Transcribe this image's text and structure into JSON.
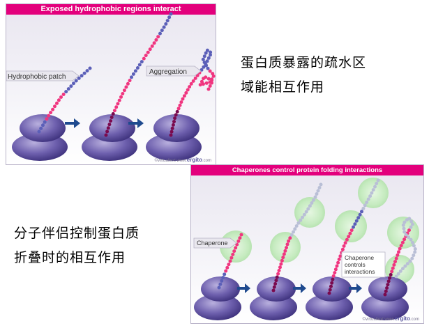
{
  "panel1": {
    "title": "Exposed hydrophobic regions interact",
    "hydrophobic_label": "Hydrophobic patch",
    "aggregation_label": "Aggregation",
    "credit_prefix": "©virtualtext www.",
    "credit_brand": "ergito",
    "credit_suffix": ".com"
  },
  "panel2": {
    "title": "Chaperones control protein folding interactions",
    "chaperone_label": "Chaperone",
    "controls_lines": [
      "Chaperone",
      "controls",
      "interactions"
    ],
    "credit_prefix": "©virtualtext www.",
    "credit_brand": "ergito",
    "credit_suffix": ".com"
  },
  "caption1": [
    "蛋白质暴露的疏水区",
    "域能相互作用"
  ],
  "caption2": [
    "分子伴侣控制蛋白质",
    "折叠时的相互作用"
  ],
  "colors": {
    "title_bar": "#e3007c",
    "bead_pink": "#f0357f",
    "bead_blue": "#5b5fb8",
    "bead_maroon": "#7a0a4e",
    "bead_grey": "#b9bfd6",
    "ribosome": "#5f4fa0",
    "arrow": "#1f4a8f",
    "chaperone": "#c9ecc4"
  }
}
